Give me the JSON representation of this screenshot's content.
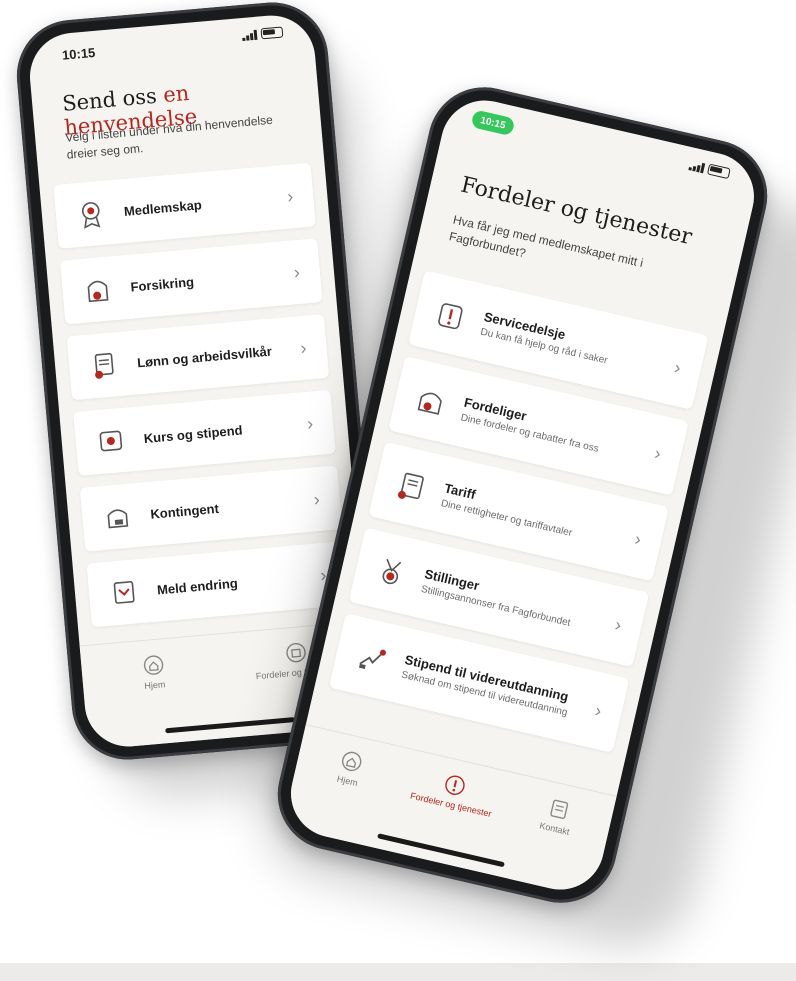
{
  "colors": {
    "accent": "#b5271f",
    "screen_bg": "#f6f4f0",
    "card_bg": "#ffffff",
    "frame": "#1a1b1d"
  },
  "left_phone": {
    "status_time": "10:15",
    "title_main": "Send oss",
    "title_accent": "en henvendelse",
    "subtitle": "Velg i listen under hva din henvendelse dreier seg om.",
    "items": [
      {
        "label": "Medlemskap",
        "icon": "membership-badge-icon"
      },
      {
        "label": "Forsikring",
        "icon": "insurance-icon"
      },
      {
        "label": "Lønn og arbeidsvilkår",
        "icon": "salary-document-icon"
      },
      {
        "label": "Kurs og stipend",
        "icon": "course-badge-icon"
      },
      {
        "label": "Kontingent",
        "icon": "payment-icon"
      },
      {
        "label": "Meld endring",
        "icon": "report-change-icon"
      }
    ],
    "tabs": [
      {
        "label": "Hjem",
        "icon": "home-icon"
      },
      {
        "label": "Fordeler og tjenester",
        "icon": "benefits-icon"
      }
    ]
  },
  "right_phone": {
    "status_pill": "10:15",
    "title": "Fordeler og tjenester",
    "subtitle": "Hva får jeg med medlemskapet mitt i Fagforbundet?",
    "items": [
      {
        "label": "Servicedelsje",
        "sub": "Du kan få hjelp og råd i saker",
        "icon": "service-icon"
      },
      {
        "label": "Fordeliger",
        "sub": "Dine fordeler og rabatter fra oss",
        "icon": "benefits-card-icon"
      },
      {
        "label": "Tariff",
        "sub": "Dine rettigheter og tariffavtaler",
        "icon": "tariff-document-icon"
      },
      {
        "label": "Stillinger",
        "sub": "Stillingsannonser fra Fagforbundet",
        "icon": "medal-icon"
      },
      {
        "label": "Stipend til videreutdanning",
        "sub": "Søknad om stipend til videreutdanning",
        "icon": "education-icon"
      }
    ],
    "tabs": [
      {
        "label": "Hjem",
        "icon": "home-icon"
      },
      {
        "label": "Fordeler og tjenester",
        "icon": "benefits-icon"
      },
      {
        "label": "Kontakt",
        "icon": "contact-icon"
      }
    ]
  }
}
